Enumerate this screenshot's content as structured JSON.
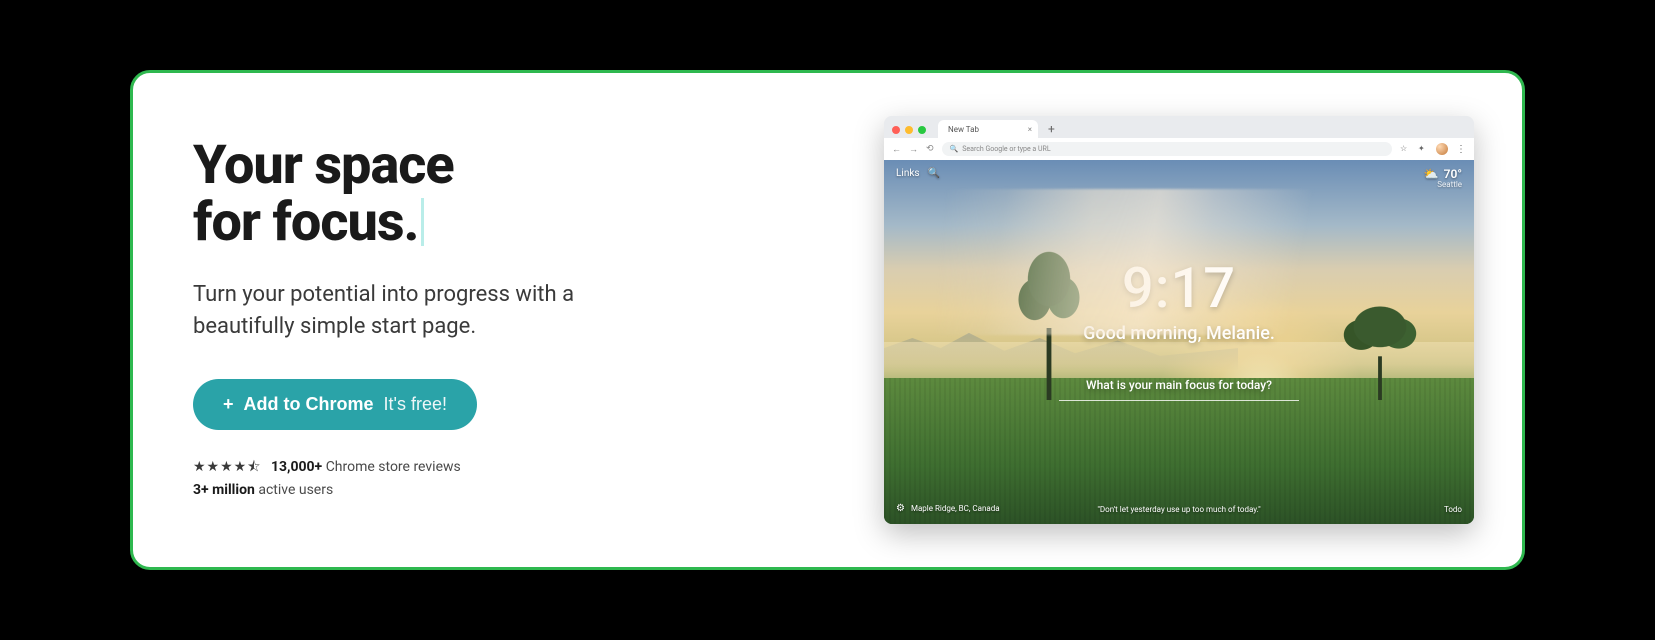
{
  "hero": {
    "title_line1": "Your space",
    "title_line2": "for focus.",
    "subtitle": "Turn your potential into progress with a beautifully simple start page.",
    "cta_plus": "+",
    "cta_main": "Add to Chrome",
    "cta_free": "It's free!",
    "stars": "★★★★⯪",
    "reviews_count": "13,000+",
    "reviews_suffix": "Chrome store reviews",
    "users_count": "3+ million",
    "users_suffix": "active users"
  },
  "browser": {
    "tab_title": "New Tab",
    "omnibox_placeholder": "Search Google or type a URL"
  },
  "scene": {
    "links_label": "Links",
    "temperature": "70°",
    "city": "Seattle",
    "clock": "9:17",
    "greeting": "Good morning, Melanie.",
    "focus_prompt": "What is your main focus for today?",
    "location": "Maple Ridge, BC, Canada",
    "quote": "\"Don't let yesterday use up too much of today.\"",
    "todo_label": "Todo"
  }
}
